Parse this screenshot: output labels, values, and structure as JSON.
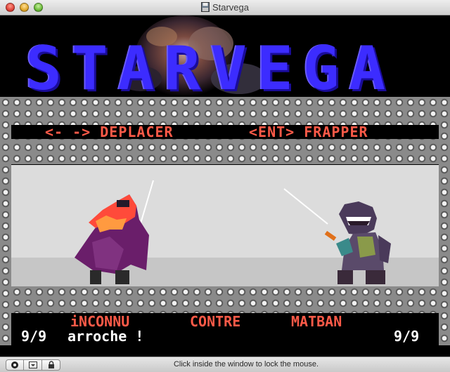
{
  "window": {
    "title": "Starvega"
  },
  "game": {
    "logo": "STARVEGA",
    "controls": {
      "move": "<- -> DEPLACER",
      "hit": "<ENT> FRAPPER"
    },
    "status": {
      "player_name": "iNCONNU",
      "versus": "CONTRE",
      "enemy_name": "MATBAN",
      "player_hp": "9/9",
      "message": "arroche !",
      "enemy_hp": "9/9"
    },
    "colors": {
      "logo": "#3c2cff",
      "red_text": "#ff5a48",
      "arena": "#dcdcdc"
    },
    "sprites": [
      "hooded-swordsman",
      "shark-alien-swordsman"
    ]
  },
  "statusbar": {
    "hint": "Click inside the window to lock the mouse.",
    "buttons": [
      "zoom-icon",
      "dropdown-icon",
      "lock-icon"
    ]
  }
}
